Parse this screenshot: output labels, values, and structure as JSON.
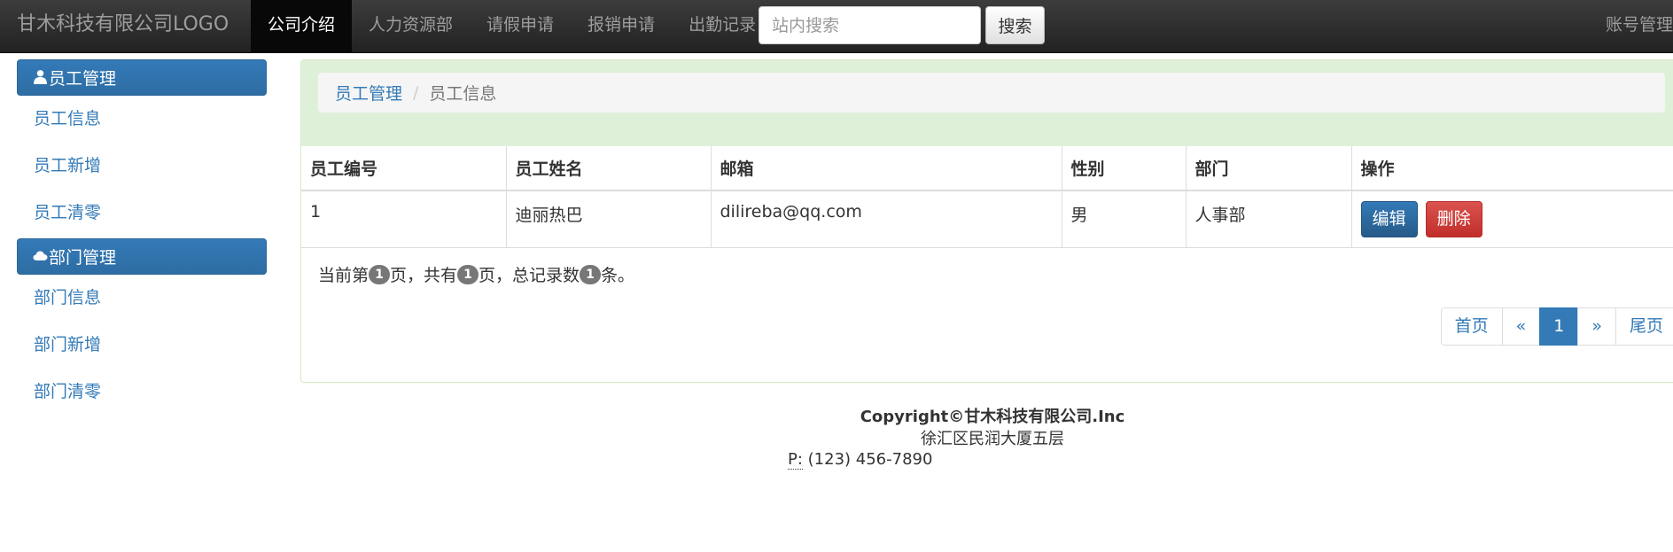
{
  "navbar": {
    "brand": "甘木科技有限公司LOGO",
    "items": [
      {
        "label": "公司介绍",
        "active": true
      },
      {
        "label": "人力资源部",
        "active": false
      },
      {
        "label": "请假申请",
        "active": false
      },
      {
        "label": "报销申请",
        "active": false
      },
      {
        "label": "出勤记录",
        "active": false
      }
    ],
    "search_placeholder": "站内搜索",
    "search_button": "搜索",
    "account": "账号管理"
  },
  "sidebar": {
    "groups": [
      {
        "title": "员工管理",
        "icon": "user-icon",
        "links": [
          "员工信息",
          "员工新增",
          "员工清零"
        ]
      },
      {
        "title": "部门管理",
        "icon": "cloud-icon",
        "links": [
          "部门信息",
          "部门新增",
          "部门清零"
        ]
      }
    ]
  },
  "breadcrumb": {
    "parent": "员工管理",
    "separator": "/",
    "current": "员工信息"
  },
  "table": {
    "headers": [
      "员工编号",
      "员工姓名",
      "邮箱",
      "性别",
      "部门",
      "操作"
    ],
    "rows": [
      {
        "id": "1",
        "name": "迪丽热巴",
        "email": "dilireba@qq.com",
        "gender": "男",
        "dept": "人事部"
      }
    ],
    "edit_label": "编辑",
    "delete_label": "删除"
  },
  "page_info": {
    "prefix": "当前第",
    "current_page": "1",
    "mid1": "页，共有",
    "total_pages": "1",
    "mid2": "页，总记录数",
    "total_records": "1",
    "suffix": "条。"
  },
  "pagination": {
    "first": "首页",
    "prev": "«",
    "current": "1",
    "next": "»",
    "last": "尾页"
  },
  "footer": {
    "copyright": "Copyright©甘木科技有限公司.Inc",
    "address": "徐汇区民润大厦五层",
    "phone_label": "P:",
    "phone": "(123) 456-7890"
  },
  "colors": {
    "primary": "#337ab7",
    "danger": "#d9534f",
    "navbar": "#222222",
    "panel_heading": "#dff0d8"
  }
}
